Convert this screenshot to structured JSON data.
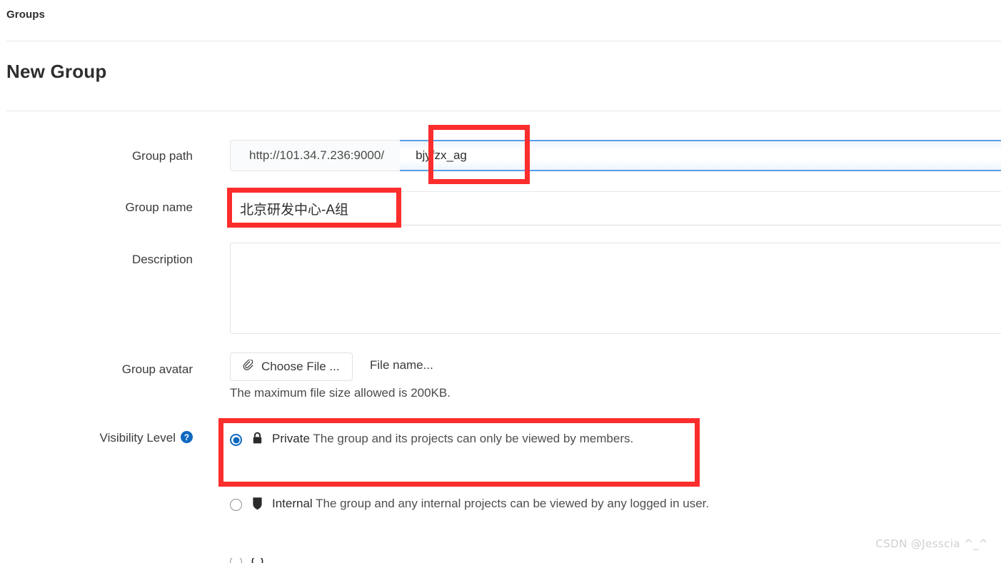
{
  "breadcrumb": {
    "label": "Groups"
  },
  "page": {
    "title": "New Group"
  },
  "form": {
    "path": {
      "label": "Group path",
      "url_prefix": "http://101.34.7.236:9000/",
      "value": "bjyfzx_ag",
      "placeholder": ""
    },
    "name": {
      "label": "Group name",
      "value": "北京研发中心-A组",
      "placeholder": ""
    },
    "description": {
      "label": "Description",
      "value": "",
      "placeholder": ""
    },
    "avatar": {
      "label": "Group avatar",
      "choose_file_label": "Choose File ...",
      "file_name_text": "File name...",
      "hint": "The maximum file size allowed is 200KB.",
      "icon": "paperclip-icon"
    },
    "visibility": {
      "label": "Visibility Level",
      "help_icon": "help-circle-icon",
      "options": [
        {
          "name": "Private",
          "description": "The group and its projects can only be viewed by members.",
          "icon": "lock-icon",
          "selected": true
        },
        {
          "name": "Internal",
          "description": "The group and any internal projects can be viewed by any logged in user.",
          "icon": "shield-icon",
          "selected": false
        }
      ]
    }
  },
  "annotations": {
    "color": "#fc2d2d",
    "boxes": [
      "group-path-input",
      "group-name-input",
      "visibility-private-option"
    ]
  },
  "watermark": {
    "text": "CSDN @Jesscia ^_^"
  },
  "colors": {
    "accent": "#1068bf",
    "focus_border": "#5a9ee8",
    "annotation": "#fc2d2d",
    "text": "#2e2e2e",
    "muted": "#4e4e4e"
  }
}
